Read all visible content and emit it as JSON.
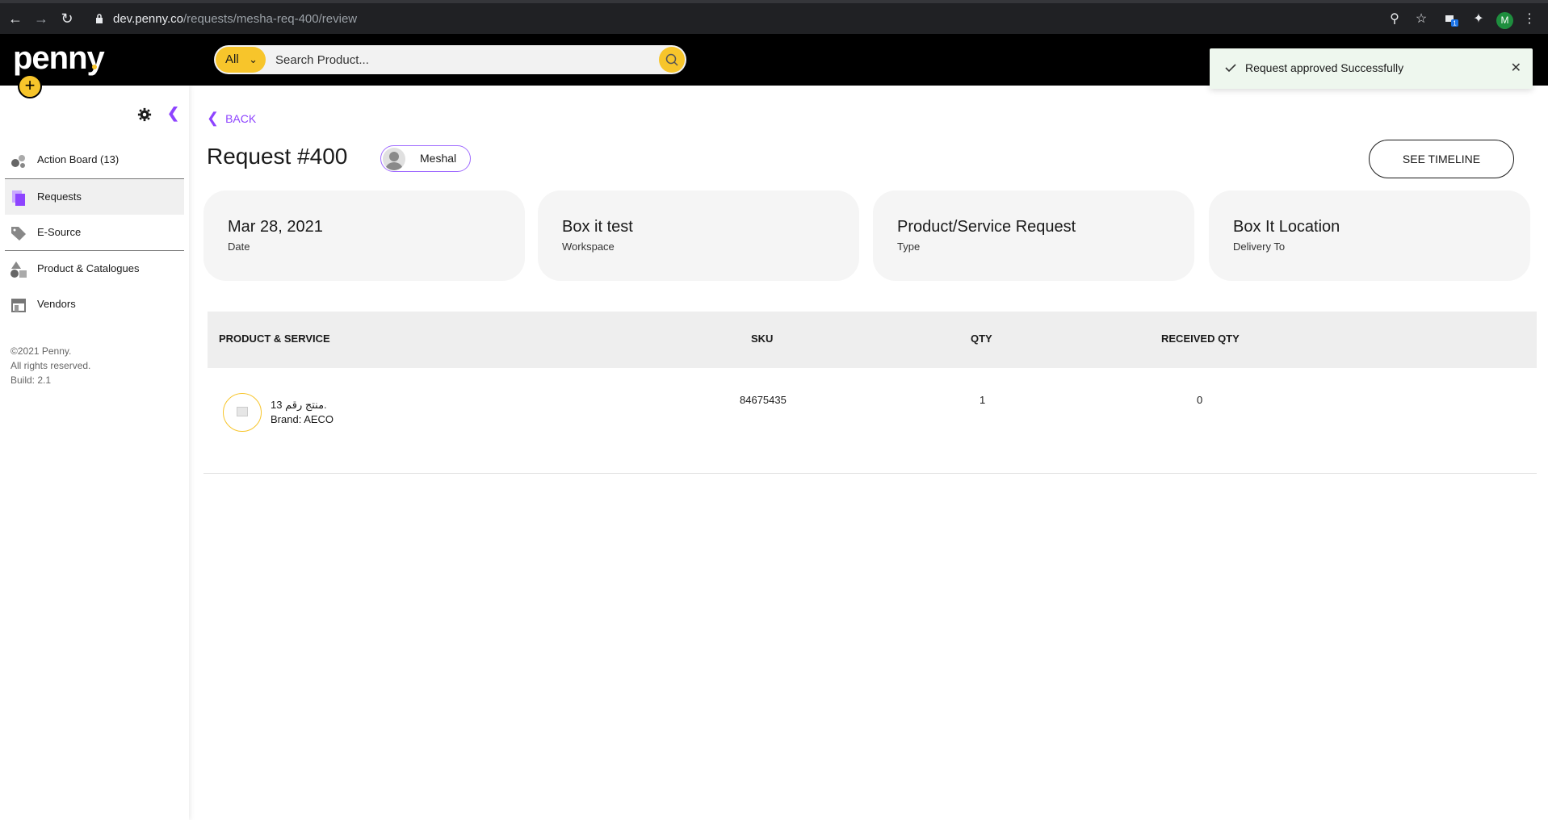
{
  "browser": {
    "url_host": "dev.penny.co",
    "url_path": "/requests/mesha-req-400/review",
    "profile_initial": "M",
    "extension_badge": "1"
  },
  "header": {
    "logo": "penny",
    "search": {
      "category": "All",
      "placeholder": "Search Product..."
    }
  },
  "toast": {
    "message": "Request approved Successfully"
  },
  "sidebar": {
    "items": [
      {
        "label": "Action Board (13)",
        "icon": "action-board-icon"
      },
      {
        "label": "Requests",
        "icon": "requests-icon"
      },
      {
        "label": "E-Source",
        "icon": "tag-icon"
      },
      {
        "label": "Product & Catalogues",
        "icon": "shapes-icon"
      },
      {
        "label": "Vendors",
        "icon": "store-icon"
      }
    ],
    "footer": [
      "©2021 Penny.",
      "All rights reserved.",
      "Build: 2.1"
    ]
  },
  "main": {
    "back_label": "BACK",
    "title": "Request #400",
    "requester": "Meshal",
    "timeline_label": "SEE TIMELINE",
    "cards": [
      {
        "value": "Mar 28, 2021",
        "label": "Date"
      },
      {
        "value": "Box it test",
        "label": "Workspace"
      },
      {
        "value": "Product/Service Request",
        "label": "Type"
      },
      {
        "value": "Box It Location",
        "label": "Delivery To"
      }
    ],
    "table": {
      "headers": [
        "PRODUCT & SERVICE",
        "SKU",
        "QTY",
        "RECEIVED QTY"
      ],
      "rows": [
        {
          "name": "منتج رقم 13.",
          "brand": "Brand: AECO",
          "sku": "84675435",
          "qty": "1",
          "received": "0"
        }
      ]
    }
  },
  "colors": {
    "accent": "#8e44ff",
    "brand_yellow": "#f7c52b",
    "header_bg": "#000000",
    "toast_bg": "#eef7ee"
  }
}
